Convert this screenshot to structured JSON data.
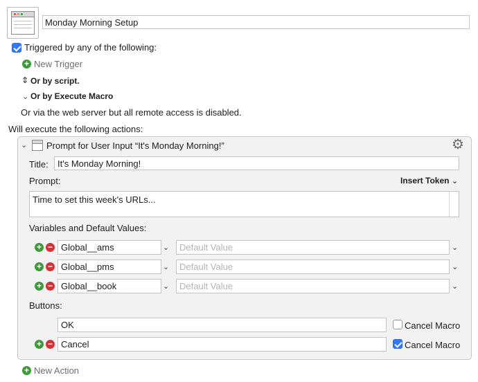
{
  "macro": {
    "name": "Monday Morning Setup",
    "icon": "window-icon"
  },
  "triggers": {
    "checkbox_checked": true,
    "label": "Triggered by any of the following:",
    "new_trigger": "New Trigger",
    "script_label": "Or by script.",
    "execute_macro_label": "Or by Execute Macro",
    "web_server_text": "Or via the web server but all remote access is disabled."
  },
  "actions_heading": "Will execute the following actions:",
  "action": {
    "title": "Prompt for User Input “It's Monday Morning!”",
    "title_label": "Title:",
    "title_value": "It's Monday Morning!",
    "prompt_label": "Prompt:",
    "insert_token": "Insert Token",
    "prompt_value": "Time to set this week's URLs...",
    "variables_label": "Variables and Default Values:",
    "variables": [
      {
        "name": "Global__ams",
        "default_placeholder": "Default Value"
      },
      {
        "name": "Global__pms",
        "default_placeholder": "Default Value"
      },
      {
        "name": "Global__book",
        "default_placeholder": "Default Value"
      }
    ],
    "buttons_label": "Buttons:",
    "buttons": [
      {
        "name": "OK",
        "cancel_macro": false,
        "cancel_label": "Cancel Macro"
      },
      {
        "name": "Cancel",
        "cancel_macro": true,
        "cancel_label": "Cancel Macro"
      }
    ]
  },
  "new_action": "New Action",
  "colors": {
    "accent": "#3478f6",
    "add": "#3f9a3b",
    "remove": "#d0343a",
    "panel_bg": "#f2f2f2"
  }
}
